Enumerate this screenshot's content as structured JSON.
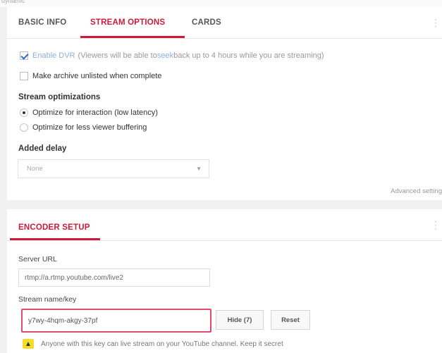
{
  "top_strip_text": "dynamic",
  "tabs": [
    {
      "label": "BASIC INFO",
      "active": false
    },
    {
      "label": "STREAM OPTIONS",
      "active": true
    },
    {
      "label": "CARDS",
      "active": false
    }
  ],
  "dvr": {
    "checked": true,
    "label": "Enable DVR",
    "note_prefix": "(Viewers will be able to ",
    "note_seek": "seek",
    "note_suffix": " back up to 4 hours while you are streaming)"
  },
  "archive": {
    "checked": false,
    "label": "Make archive unlisted when complete"
  },
  "optimizations": {
    "title": "Stream optimizations",
    "options": [
      {
        "label": "Optimize for interaction (low latency)",
        "selected": true
      },
      {
        "label": "Optimize for less viewer buffering",
        "selected": false
      }
    ]
  },
  "delay": {
    "title": "Added delay",
    "value": "None"
  },
  "advanced_link": "Advanced setting",
  "encoder": {
    "title": "ENCODER SETUP",
    "server_url_label": "Server URL",
    "server_url": "rtmp://a.rtmp.youtube.com/live2",
    "stream_key_label": "Stream name/key",
    "stream_key": "y7wy-4hqm-akgy-37pf",
    "hide_label": "Hide (7)",
    "reset_label": "Reset",
    "warning": "Anyone with this key can live stream on your YouTube channel. Keep it secret"
  },
  "colors": {
    "accent": "#cc1a3a",
    "highlight_border": "#e24a6b",
    "warning": "#f3dc2c",
    "check": "#2e6bc4"
  }
}
